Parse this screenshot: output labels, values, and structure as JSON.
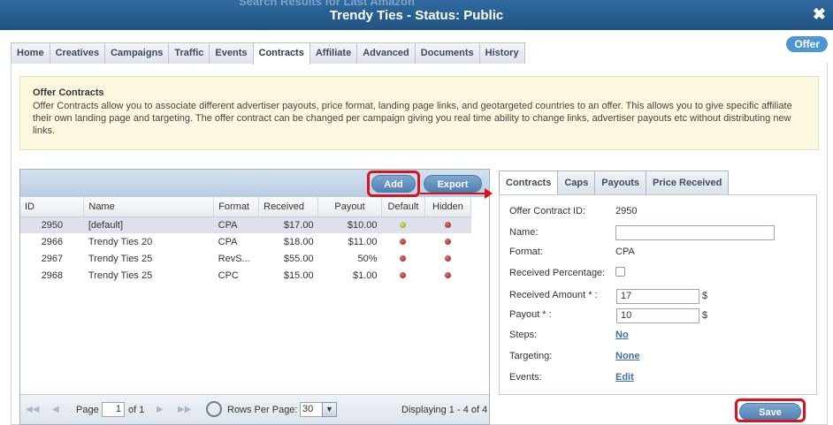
{
  "titlebar": {
    "ghost_text": "Search Results for Last Amazon",
    "title": "Trendy Ties - Status: Public",
    "close": "✖"
  },
  "entity_badge": "Offer",
  "tabs": [
    {
      "label": "Home"
    },
    {
      "label": "Creatives"
    },
    {
      "label": "Campaigns"
    },
    {
      "label": "Traffic"
    },
    {
      "label": "Events"
    },
    {
      "label": "Contracts",
      "active": true
    },
    {
      "label": "Affiliate"
    },
    {
      "label": "Advanced"
    },
    {
      "label": "Documents"
    },
    {
      "label": "History"
    }
  ],
  "info": {
    "heading": "Offer Contracts",
    "text": "Offer Contracts allow you to associate different advertiser payouts, price format, landing page links, and geotargeted countries to an offer. This allows you to give specific affiliate their own landing page and targeting. The offer contract can be changed per campaign giving you real time ability to change links, advertiser payouts etc without distributing new links."
  },
  "grid": {
    "add_label": "Add",
    "export_label": "Export",
    "columns": [
      "ID",
      "Name",
      "Format",
      "Received",
      "Payout",
      "Default",
      "Hidden"
    ],
    "rows": [
      {
        "id": "2950",
        "name": "[default]",
        "format": "CPA",
        "received": "$17.00",
        "payout": "$10.00",
        "default": true,
        "hidden": false
      },
      {
        "id": "2966",
        "name": "Trendy Ties 20",
        "format": "CPA",
        "received": "$18.00",
        "payout": "$11.00",
        "default": false,
        "hidden": false
      },
      {
        "id": "2967",
        "name": "Trendy Ties 25",
        "format": "RevS...",
        "received": "$55.00",
        "payout": "50%",
        "default": false,
        "hidden": false
      },
      {
        "id": "2968",
        "name": "Trendy Ties 25",
        "format": "CPC",
        "received": "$15.00",
        "payout": "$1.00",
        "default": false,
        "hidden": false
      }
    ]
  },
  "pager": {
    "page_label": "Page",
    "page_value": "1",
    "of_label": "of 1",
    "rows_per_page_label": "Rows Per Page:",
    "rows_per_page_value": "30",
    "displaying": "Displaying 1 - 4 of 4"
  },
  "detail_tabs": [
    {
      "label": "Contracts",
      "active": true
    },
    {
      "label": "Caps"
    },
    {
      "label": "Payouts"
    },
    {
      "label": "Price Received"
    }
  ],
  "detail": {
    "offer_contract_id_label": "Offer Contract ID:",
    "offer_contract_id": "2950",
    "name_label": "Name:",
    "name_value": "",
    "format_label": "Format:",
    "format_value": "CPA",
    "received_percentage_label": "Received Percentage:",
    "received_amount_label": "Received Amount * :",
    "received_amount_value": "17",
    "payout_label": "Payout * :",
    "payout_value": "10",
    "currency_symbol": "$",
    "steps_label": "Steps:",
    "steps_value": "No",
    "targeting_label": "Targeting:",
    "targeting_value": "None",
    "events_label": "Events:",
    "events_value": "Edit"
  },
  "save_label": "Save",
  "colors": {
    "titlebar": "#21537f",
    "highlight": "#d9121b",
    "button": "#4e7fb3",
    "info_bg": "#fdf9e1",
    "selected_row": "#dfe0ee"
  }
}
